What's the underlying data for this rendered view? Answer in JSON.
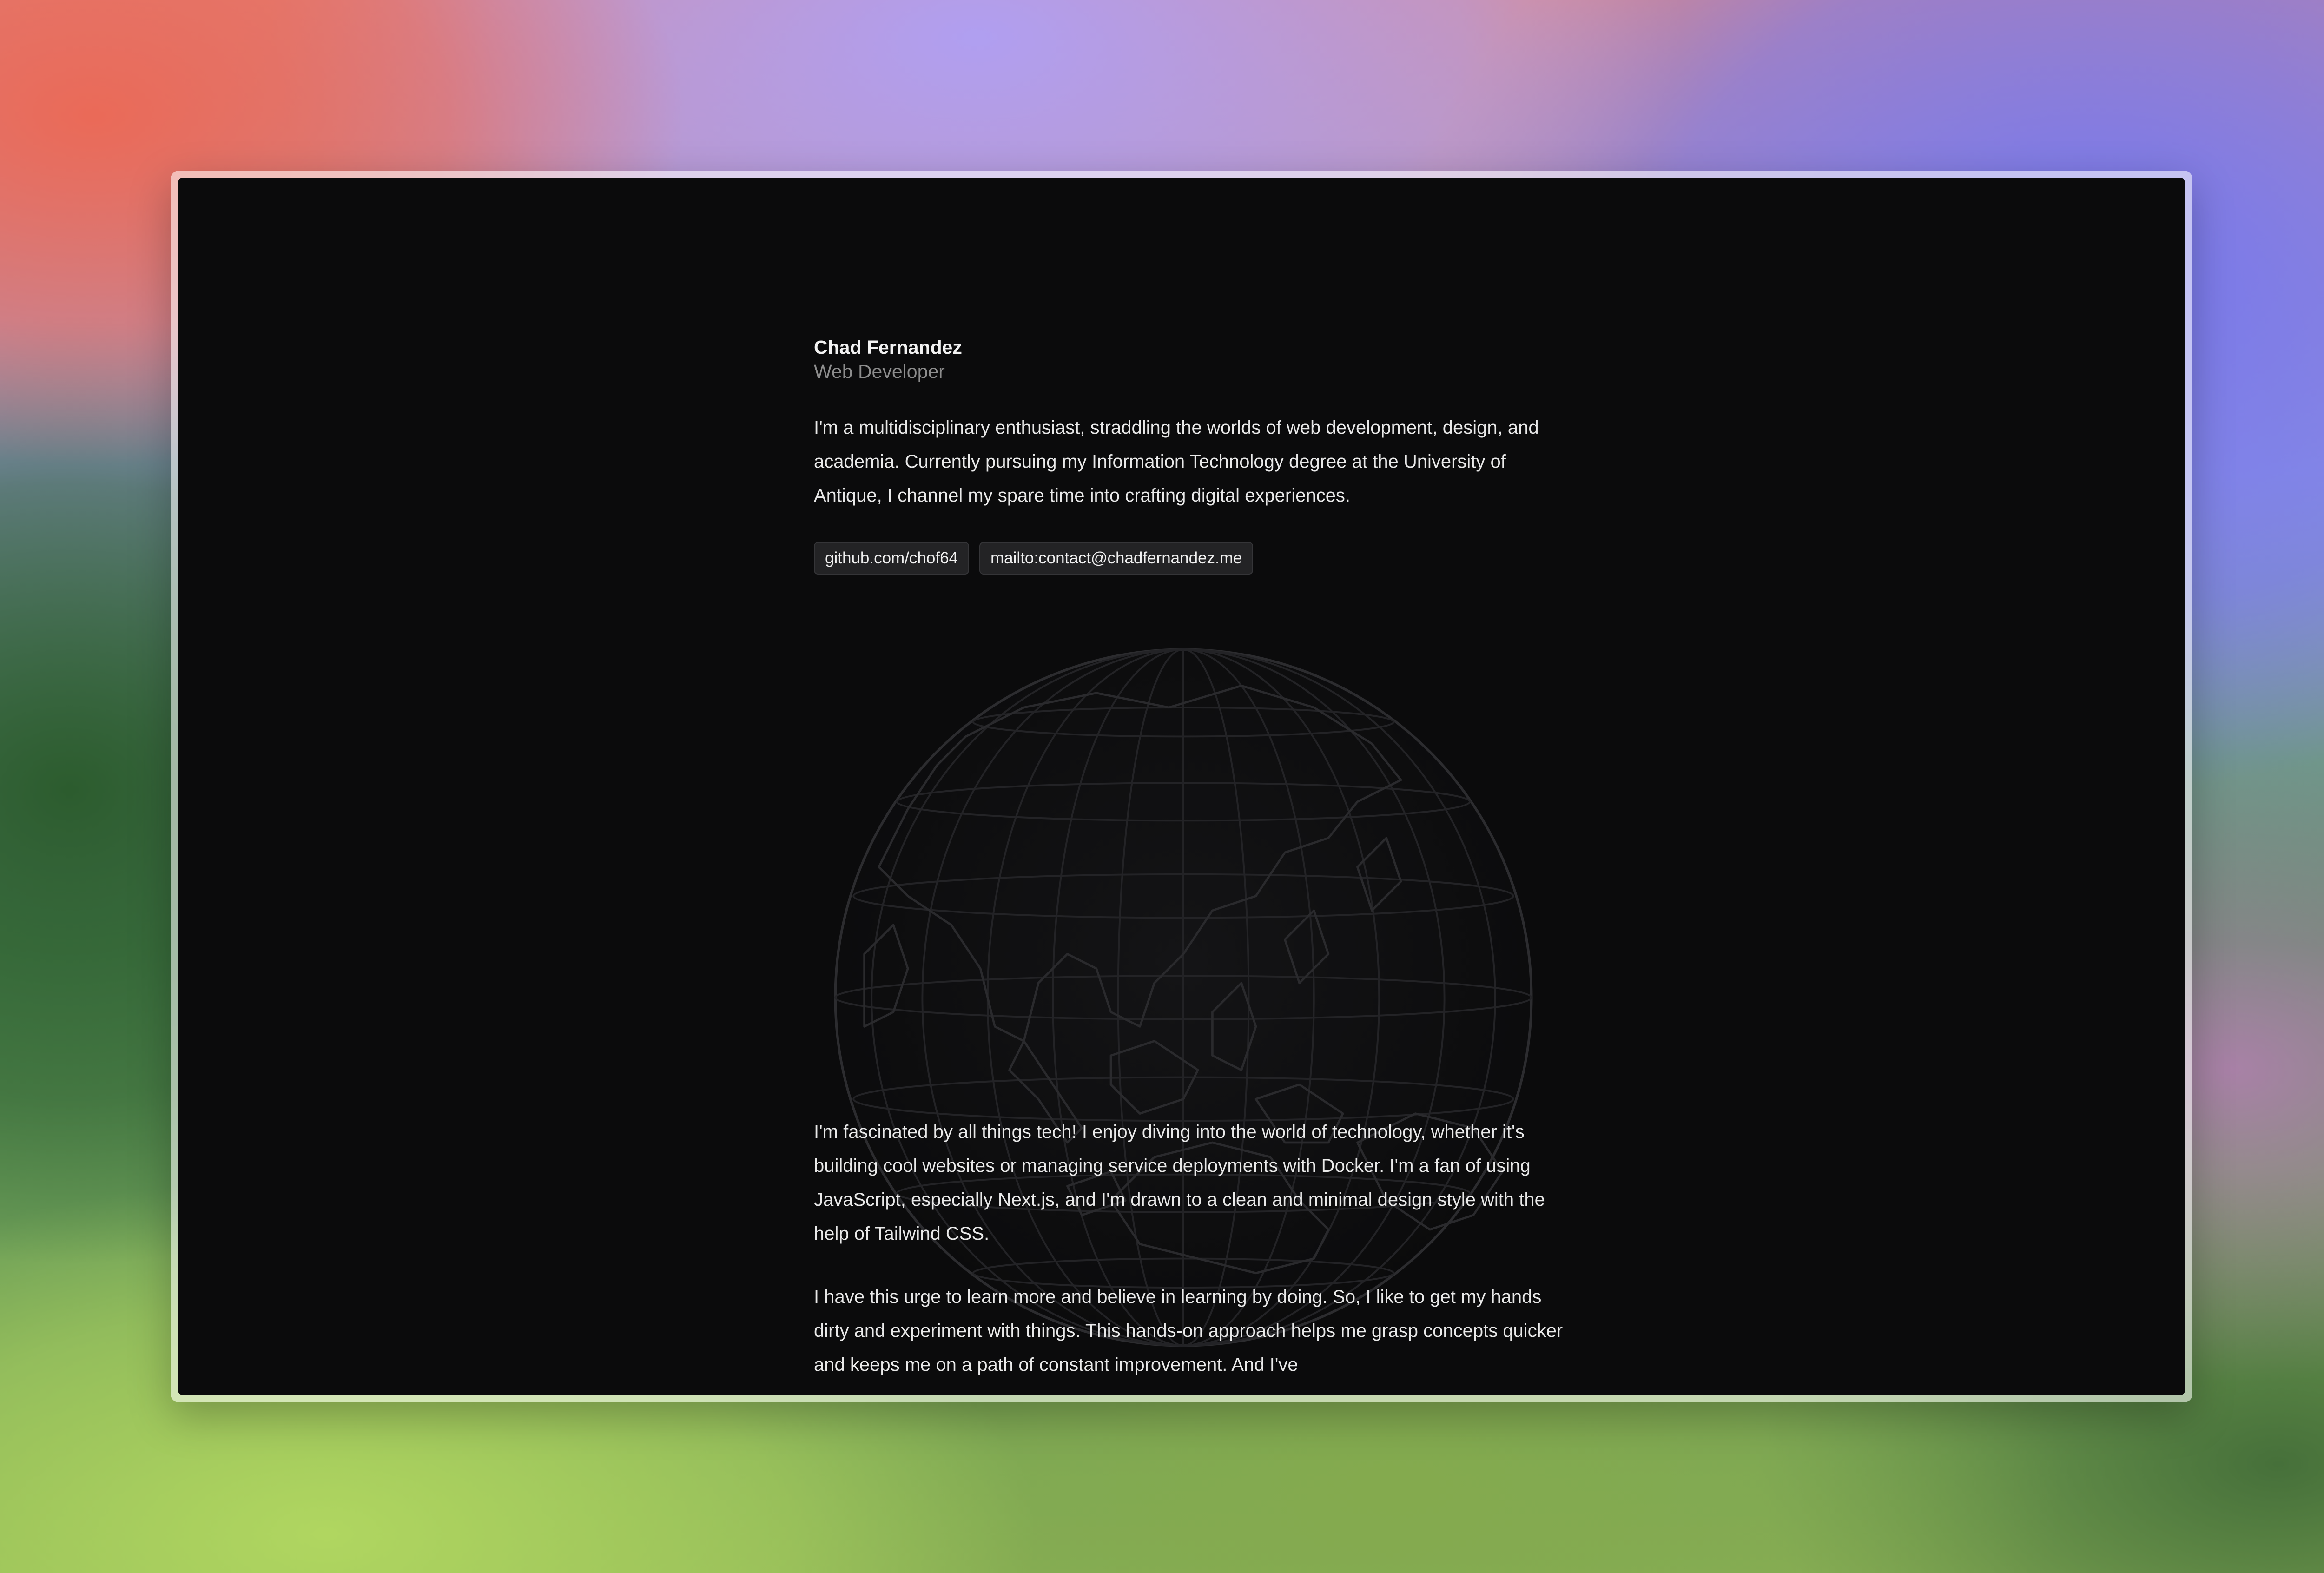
{
  "profile": {
    "name": "Chad Fernandez",
    "role": "Web Developer"
  },
  "intro": "I'm a multidisciplinary enthusiast, straddling the worlds of web development, design, and academia. Currently pursuing my Information Technology degree at the University of Antique, I channel my spare time into crafting digital experiences.",
  "links": [
    {
      "label": "github.com/chof64"
    },
    {
      "label": "mailto:contact@chadfernandez.me"
    }
  ],
  "about": [
    "I'm fascinated by all things tech! I enjoy diving into the world of technology, whether it's building cool websites or managing service deployments with Docker. I'm a fan of using JavaScript, especially Next.js, and I'm drawn to a clean and minimal design style with the help of Tailwind CSS.",
    "I have this urge to learn more and believe in learning by doing. So, I like to get my hands dirty and experiment with things. This hands-on approach helps me grasp concepts quicker and keeps me on a path of constant improvement. And I've"
  ],
  "colors": {
    "screen_bg": "#0b0b0c",
    "text": "#e9e9e9",
    "muted": "#8d8d8d",
    "chip_bg": "#232325",
    "globe_line": "#2a2a2c"
  },
  "globe": {
    "icon": "wireframe-globe",
    "region": "Asia-Pacific"
  }
}
